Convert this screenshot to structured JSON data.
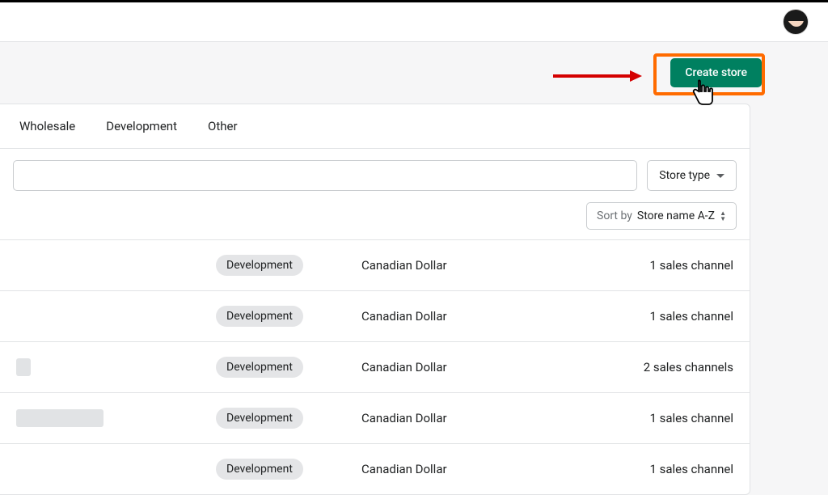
{
  "header": {},
  "actions": {
    "create_store_label": "Create store"
  },
  "tabs": [
    {
      "label": "Wholesale"
    },
    {
      "label": "Development"
    },
    {
      "label": "Other"
    }
  ],
  "filters": {
    "store_type_label": "Store type"
  },
  "sort": {
    "prefix": "Sort by",
    "value": "Store name A-Z"
  },
  "rows": [
    {
      "badge": "Development",
      "currency": "Canadian Dollar",
      "channels": "1 sales channel",
      "name_placeholder_width": 0
    },
    {
      "badge": "Development",
      "currency": "Canadian Dollar",
      "channels": "1 sales channel",
      "name_placeholder_width": 0
    },
    {
      "badge": "Development",
      "currency": "Canadian Dollar",
      "channels": "2 sales channels",
      "name_placeholder_width": 18
    },
    {
      "badge": "Development",
      "currency": "Canadian Dollar",
      "channels": "1 sales channel",
      "name_placeholder_width": 108
    },
    {
      "badge": "Development",
      "currency": "Canadian Dollar",
      "channels": "1 sales channel",
      "name_placeholder_width": 0
    }
  ]
}
